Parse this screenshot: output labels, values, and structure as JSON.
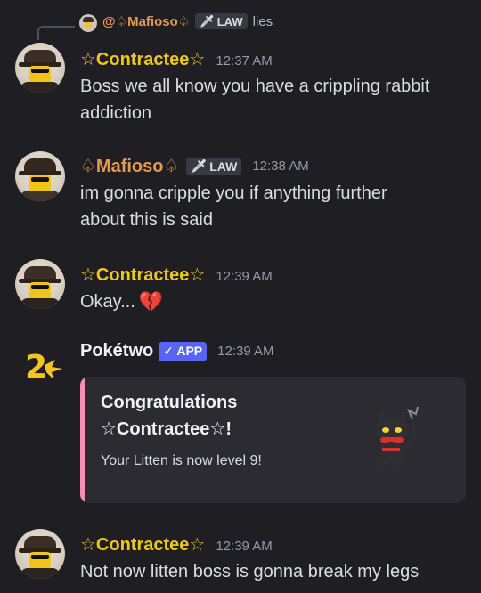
{
  "reply": {
    "name": "@♤Mafioso♤",
    "tag": "LAW",
    "text": "lies"
  },
  "messages": [
    {
      "author": "☆Contractee☆",
      "time": "12:37 AM",
      "lines": [
        "Boss we all know you have a crippling rabbit",
        "addiction"
      ]
    },
    {
      "author": "♤Mafioso♤",
      "tag": "LAW",
      "time": "12:38 AM",
      "lines": [
        "im gonna cripple you if anything further",
        "about this is said"
      ]
    },
    {
      "author": "☆Contractee☆",
      "time": "12:39 AM",
      "text": "Okay...",
      "emoji": "💔"
    },
    {
      "author": "Pokétwo",
      "badge": "✓ APP",
      "time": "12:39 AM",
      "embed": {
        "title_line1": "Congratulations",
        "title_line2": "☆Contractee☆!",
        "description": "Your Litten is now level 9!"
      }
    },
    {
      "author": "☆Contractee☆",
      "time": "12:39 AM",
      "text": "Not now litten boss is gonna break my legs"
    }
  ],
  "colors": {
    "background": "#1f1f23",
    "contractee": "#f0c619",
    "mafioso": "#e39a52",
    "app_badge": "#5865f2",
    "embed_accent": "#f48fb1"
  }
}
